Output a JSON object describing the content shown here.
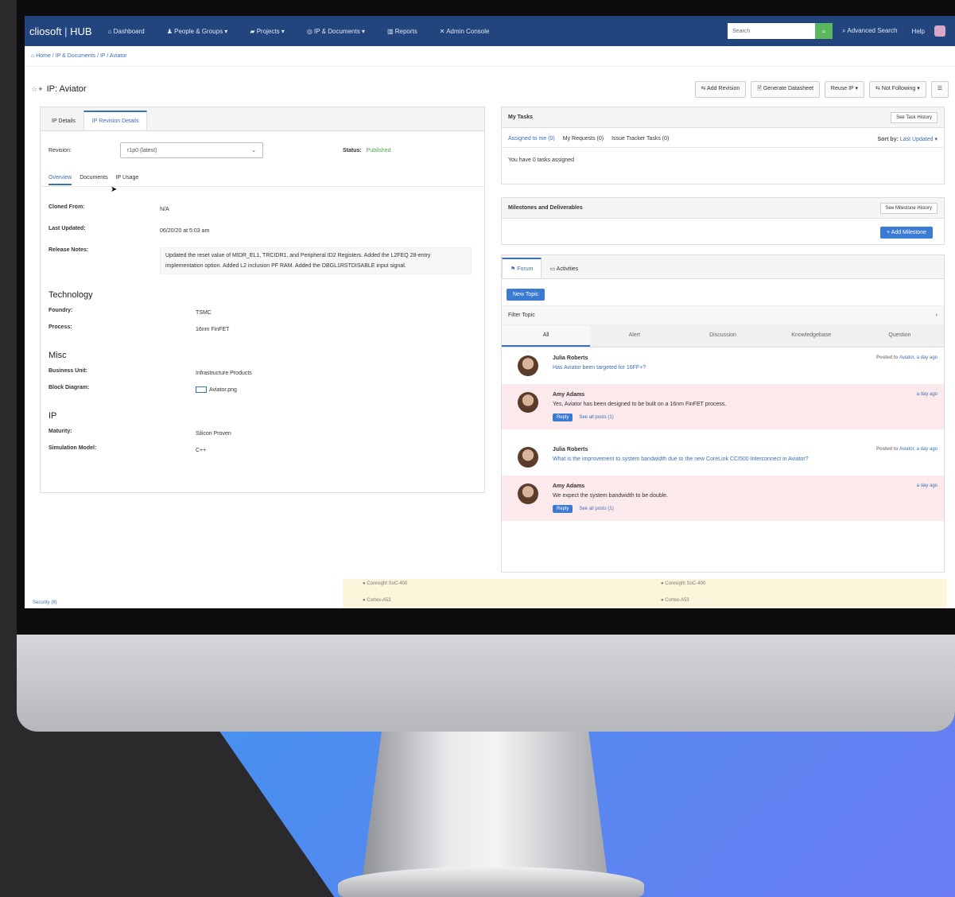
{
  "nav": {
    "brand_a": "cliosoft",
    "brand_b": "HUB",
    "items": [
      "Dashboard",
      "People & Groups ▾",
      "Projects ▾",
      "IP & Documents ▾",
      "Reports",
      "Admin Console"
    ],
    "search_placeholder": "Search",
    "advanced_search": "Advanced Search",
    "help": "Help"
  },
  "breadcrumb": "Home / IP & Documents / IP / Aviator",
  "title": "IP: Aviator",
  "actions": [
    "Add Revision",
    "Generate Datasheet",
    "Reuse IP ▾",
    "Not Following ▾"
  ],
  "left": {
    "tabs": [
      "IP Details",
      "IP Revision Details"
    ],
    "revision_label": "Revision:",
    "revision_value": "r1p0 (latest)",
    "status_label": "Status:",
    "status_value": "Published",
    "subtabs": [
      "Overview",
      "Documents",
      "IP Usage"
    ],
    "fields": [
      {
        "k": "Cloned From:",
        "v": "N/A"
      },
      {
        "k": "Last Updated:",
        "v": "06/20/20 at 5:03 am"
      }
    ],
    "release_label": "Release Notes:",
    "release_notes": "Updated the reset value of MIDR_EL1, TRCIDR1, and Peripheral ID2 Registers. Added the L2FEQ 28-entry implementation option. Added L2 inclusion PF RAM. Added the DBGL1RSTDISABLE input signal.",
    "technology": "Technology",
    "tech_fields": [
      {
        "k": "Foundry:",
        "v": "TSMC"
      },
      {
        "k": "Process:",
        "v": "16nm FinFET"
      }
    ],
    "misc": "Misc",
    "misc_fields": [
      {
        "k": "Business Unit:",
        "v": "Infrastructure Products"
      },
      {
        "k": "Block Diagram:",
        "v": "Aviator.png"
      }
    ],
    "ip": "IP",
    "ip_fields": [
      {
        "k": "Maturity:",
        "v": "Silicon Proven"
      },
      {
        "k": "Simulation Model:",
        "v": "C++"
      }
    ]
  },
  "tasks": {
    "title": "My Tasks",
    "history_btn": "See Task History",
    "tabs": [
      "Assigned to me (0)",
      "My Requests (0)",
      "Issue Tracker Tasks (0)"
    ],
    "sort_label": "Sort by:",
    "sort_value": "Last Updated",
    "note": "You have 0 tasks assigned"
  },
  "milestones": {
    "title": "Milestones and Deliverables",
    "history_btn": "See Milestone History",
    "add_btn": "+ Add Milestone"
  },
  "forum": {
    "tabs": [
      "Forum",
      "Activities"
    ],
    "new_topic": "New Topic",
    "filter": "Filter Topic",
    "categories": [
      "All",
      "Alert",
      "Discussion",
      "Knowledgebase",
      "Question"
    ],
    "posts": [
      {
        "author": "Julia Roberts",
        "text": "Has Aviator been targeted for 16FF+?",
        "meta_a": "Posted to ",
        "meta_link": "Aviator",
        "meta_b": ", a day ago"
      },
      {
        "author": "Amy Adams",
        "text": "Yes, Aviator has been designed to be built on a 16nm FinFET process.",
        "meta": "a day ago",
        "reply": "Reply",
        "see_all": "See all posts (1)"
      },
      {
        "author": "Julia Roberts",
        "text": "What is the improvement to system bandwidth due to the new CoreLink CCI500 Interconnect in Aviator?",
        "meta_a": "Posted to ",
        "meta_link": "Aviator",
        "meta_b": ", a day ago"
      },
      {
        "author": "Amy Adams",
        "text": "We expect the system bandwidth to be double.",
        "meta": "a day ago",
        "reply": "Reply",
        "see_all": "See all posts (1)"
      }
    ]
  },
  "strip": {
    "a": "Coresight SoC-400",
    "b": "Cortex-A53",
    "left": "Security (8)"
  },
  "colors": {
    "nav": "#23457e",
    "accent": "#3b6fb6",
    "success": "#4aa84a",
    "reply_bg": "#fbe9ec"
  }
}
